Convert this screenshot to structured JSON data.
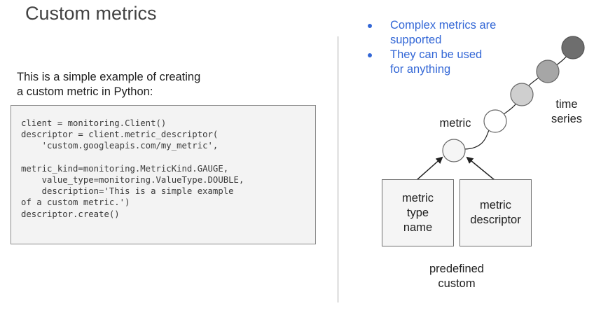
{
  "title": "Custom metrics",
  "intro": {
    "line1": "This is a simple example of creating",
    "line2": "a custom metric in Python:"
  },
  "code": {
    "lines": [
      "client = monitoring.Client()",
      "descriptor = client.metric_descriptor(",
      "    'custom.googleapis.com/my_metric',",
      "",
      "metric_kind=monitoring.MetricKind.GAUGE,",
      "    value_type=monitoring.ValueType.DOUBLE,",
      "    description='This is a simple example",
      "of a custom metric.')",
      "descriptor.create()"
    ]
  },
  "bullets": [
    {
      "line1": "Complex metrics are",
      "line2": "supported"
    },
    {
      "line1": "They can be used",
      "line2": "for anything"
    }
  ],
  "diagram": {
    "metric_label": "metric",
    "time_series_label": {
      "line1": "time",
      "line2": "series"
    },
    "box_type_name": {
      "line1": "metric",
      "line2": "type",
      "line3": "name"
    },
    "box_descriptor": {
      "line1": "metric",
      "line2": "descriptor"
    },
    "footer": {
      "line1": "predefined",
      "line2": "custom"
    },
    "colors": {
      "circle_fills": [
        "#f5f5f5",
        "#ffffff",
        "#cfcfcf",
        "#a6a6a6",
        "#6e6e6e"
      ],
      "accent_blue": "#3367d6"
    }
  }
}
